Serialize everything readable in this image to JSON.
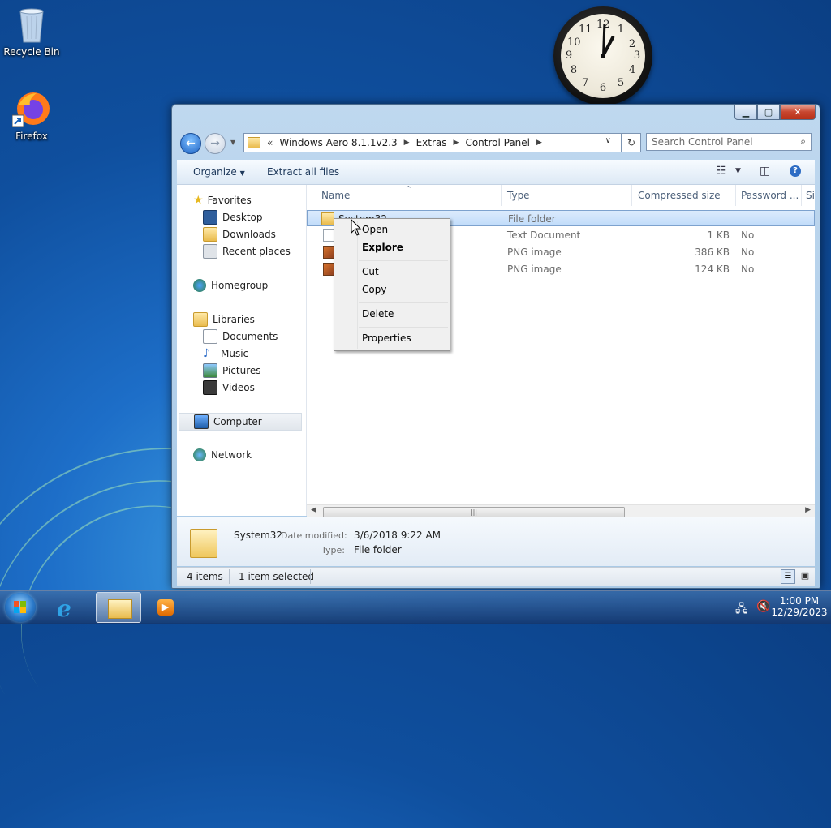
{
  "desktop": {
    "icons": [
      {
        "label": "Recycle Bin",
        "icon": "recycle-bin-icon"
      },
      {
        "label": "Firefox",
        "icon": "firefox-icon"
      }
    ],
    "clock_gadget": {
      "time": "1:00",
      "numbers": [
        "12",
        "1",
        "2",
        "3",
        "4",
        "5",
        "6",
        "7",
        "8",
        "9",
        "10",
        "11"
      ]
    }
  },
  "window": {
    "address": {
      "overflow": "«",
      "crumbs": [
        "Windows Aero 8.1.1v2.3",
        "Extras",
        "Control Panel"
      ]
    },
    "search_placeholder": "Search Control Panel",
    "toolbar": {
      "organize": "Organize",
      "extract_all": "Extract all files"
    },
    "nav_pane": {
      "favorites": "Favorites",
      "favorites_items": [
        "Desktop",
        "Downloads",
        "Recent places"
      ],
      "homegroup": "Homegroup",
      "libraries": "Libraries",
      "libraries_items": [
        "Documents",
        "Music",
        "Pictures",
        "Videos"
      ],
      "computer": "Computer",
      "network": "Network"
    },
    "columns": [
      "Name",
      "Type",
      "Compressed size",
      "Password ...",
      "Si"
    ],
    "files": [
      {
        "name": "System32",
        "type": "File folder",
        "size": "",
        "password": "",
        "icon": "folder-icon"
      },
      {
        "name": "",
        "type": "Text Document",
        "size": "1 KB",
        "password": "No",
        "icon": "text-document-icon"
      },
      {
        "name": "",
        "type": "PNG image",
        "size": "386 KB",
        "password": "No",
        "icon": "image-icon"
      },
      {
        "name": "",
        "type": "PNG image",
        "size": "124 KB",
        "password": "No",
        "icon": "image-icon"
      }
    ],
    "details": {
      "name": "System32",
      "date_label": "Date modified:",
      "date_value": "3/6/2018 9:22 AM",
      "type_label": "Type:",
      "type_value": "File folder"
    },
    "status": {
      "items": "4 items",
      "selected": "1 item selected"
    }
  },
  "context_menu": [
    "Open",
    "Explore",
    "Cut",
    "Copy",
    "Delete",
    "Properties"
  ],
  "taskbar": {
    "time": "1:00 PM",
    "date": "12/29/2023"
  },
  "colors": {
    "selection": "#c1dcfa",
    "window_frame": "#a9c9e6",
    "close_button": "#c8462f"
  }
}
